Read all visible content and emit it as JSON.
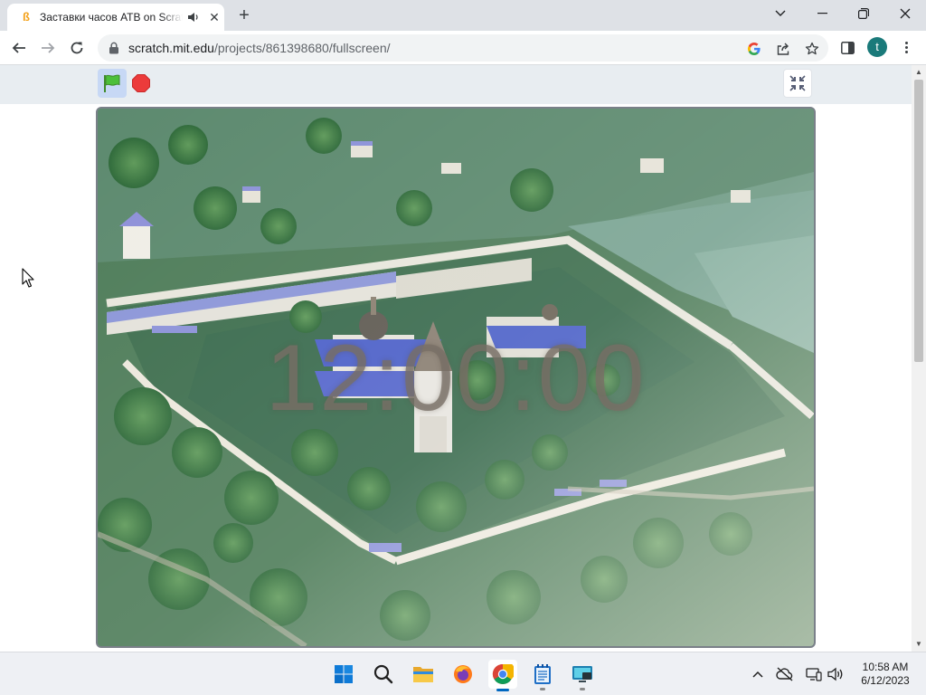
{
  "browser": {
    "tab": {
      "title": "Заставки часов АТВ on Scratch",
      "favicon_glyph": "ß",
      "audio_icon": "speaker-icon",
      "close_glyph": "✕"
    },
    "new_tab_glyph": "+",
    "window_controls": {
      "dropdown_glyph": "⌄",
      "minimize_glyph": "—",
      "restore_glyph": "❐",
      "close_glyph": "✕"
    },
    "url": {
      "host": "scratch.mit.edu",
      "path": "/projects/861398680/fullscreen/"
    },
    "profile_initial": "t",
    "profile_color": "#1a7a7a"
  },
  "scratch": {
    "clock_text": "12:00:00",
    "flag_active": true,
    "colors": {
      "header": "#e8edf1",
      "flag_bg": "#c7d8f5",
      "flag": "#46b839",
      "stop": "#ec3b3b"
    }
  },
  "taskbar": {
    "apps": [
      "windows-start",
      "search",
      "file-explorer",
      "firefox",
      "chrome",
      "notepad",
      "remote-desktop"
    ],
    "active_app": "chrome",
    "clock": {
      "time": "10:58 AM",
      "date": "6/12/2023"
    }
  }
}
